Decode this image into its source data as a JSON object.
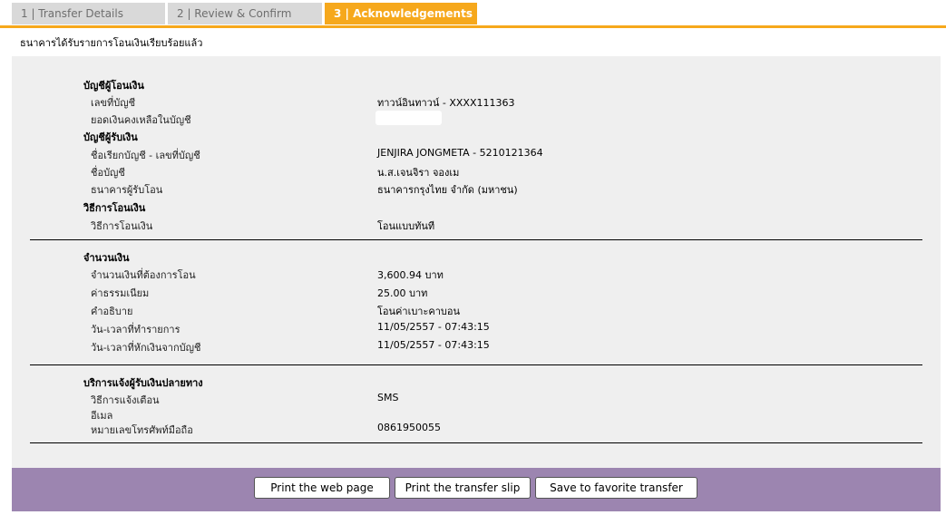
{
  "tabs": [
    {
      "label": "1 | Transfer Details"
    },
    {
      "label": "2 | Review & Confirm"
    },
    {
      "label": "3 | Acknowledgements"
    }
  ],
  "status_message": "ธนาคารได้รับรายการโอนเงินเรียบร้อยแล้ว",
  "from_account": {
    "heading": "บัญชีผู้โอนเงิน",
    "account_no_label": "เลขที่บัญชี",
    "account_no_value": "ทาวน์อินทาวน์ - XXXX111363",
    "balance_label": "ยอดเงินคงเหลือในบัญชี"
  },
  "to_account": {
    "heading": "บัญชีผู้รับเงิน",
    "nickname_label": "ชื่อเรียกบัญชี - เลขที่บัญชี",
    "nickname_value": "JENJIRA JONGMETA - 5210121364",
    "name_label": "ชื่อบัญชี",
    "name_value": "น.ส.เจนจิรา จองเม",
    "bank_label": "ธนาคารผู้รับโอน",
    "bank_value": "ธนาคารกรุงไทย จำกัด (มหาชน)"
  },
  "method": {
    "heading": "วิธีการโอนเงิน",
    "label": "วิธีการโอนเงิน",
    "value": "โอนแบบทันที"
  },
  "amount": {
    "heading": "จำนวนเงิน",
    "amount_label": "จำนวนเงินที่ต้องการโอน",
    "amount_value": "3,600.94 บาท",
    "fee_label": "ค่าธรรมเนียม",
    "fee_value": "25.00  บาท",
    "desc_label": "คำอธิบาย",
    "desc_value": "โอนค่าเบาะคาบอน",
    "txn_time_label": "วัน-เวลาที่ทำรายการ",
    "txn_time_value": "11/05/2557 - 07:43:15",
    "debit_time_label": "วัน-เวลาที่หักเงินจากบัญชี",
    "debit_time_value": "11/05/2557 - 07:43:15"
  },
  "notify": {
    "heading": "บริการแจ้งผู้รับเงินปลายทาง",
    "method_label": "วิธีการแจ้งเตือน",
    "method_value": "SMS",
    "email_label": "อีเมล",
    "phone_label": "หมายเลขโทรศัพท์มือถือ",
    "phone_value": "0861950055"
  },
  "buttons": {
    "print_page": "Print the web page",
    "print_slip": "Print the transfer slip",
    "save_favorite": "Save to favorite transfer"
  }
}
